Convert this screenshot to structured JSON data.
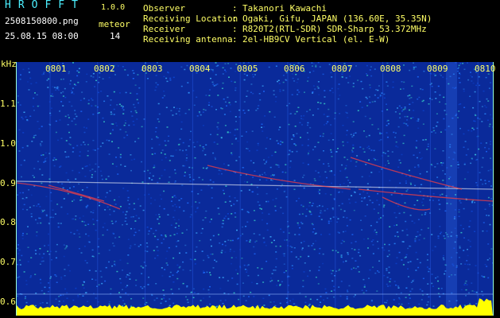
{
  "app": {
    "title": "HROFFT",
    "version": "1.0.0"
  },
  "file": {
    "name": "2508150800.png",
    "datetime": "25.08.15 08:00"
  },
  "meteor": {
    "label": "meteor",
    "count": "14"
  },
  "info": [
    {
      "label": "Observer",
      "value": "Takanori Kawachi"
    },
    {
      "label": "Receiving Location",
      "value": "Ogaki, Gifu, JAPAN (136.60E, 35.35N)"
    },
    {
      "label": "Receiver",
      "value": "R820T2(RTL-SDR) SDR-Sharp 53.372MHz"
    },
    {
      "label": "Receiving antenna",
      "value": "2el-HB9CV Vertical (el. E-W)"
    }
  ],
  "colon": ":",
  "spectrogram": {
    "unit": "kHz",
    "time_ticks": [
      "0801",
      "0802",
      "0803",
      "0804",
      "0805",
      "0806",
      "0807",
      "0808",
      "0809",
      "0810"
    ],
    "freq_ticks": [
      "1.1",
      "1.0",
      "0.9",
      "0.8",
      "0.7",
      "0.6"
    ],
    "colors": {
      "background": "#0a2a9a",
      "noise": "#1e6cff",
      "trace": "#ff4040",
      "carrier": "#ffffff",
      "baseline": "#ffff00"
    }
  }
}
